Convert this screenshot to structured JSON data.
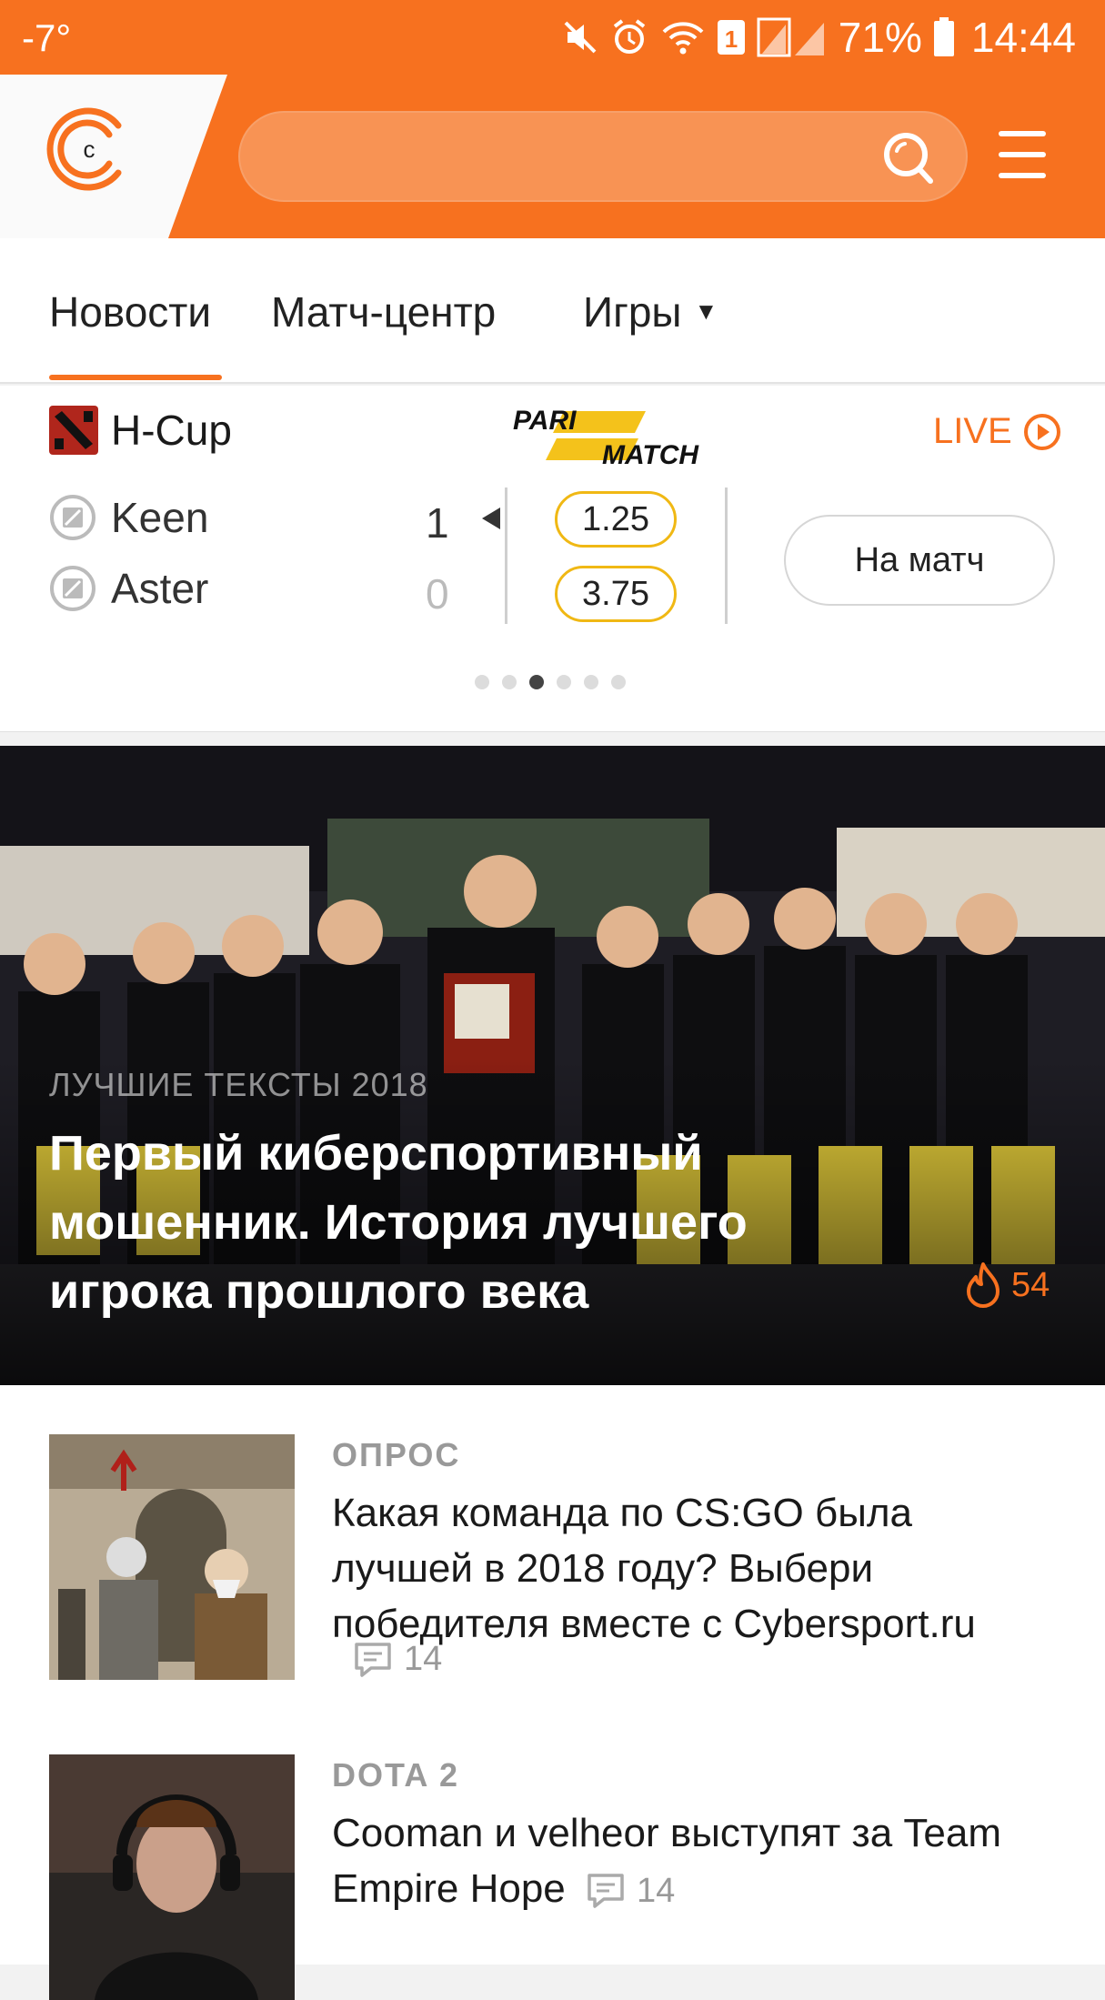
{
  "status_bar": {
    "temperature": "-7°",
    "battery": "71%",
    "time": "14:44",
    "sim_badge": "1"
  },
  "header": {
    "search": {
      "value": "",
      "placeholder": ""
    }
  },
  "tabs": [
    {
      "label": "Новости",
      "active": true
    },
    {
      "label": "Матч-центр",
      "active": false
    },
    {
      "label": "Игры",
      "active": false
    }
  ],
  "match": {
    "tournament": "H-Cup",
    "sponsor": "PARIMATCH",
    "live_label": "LIVE",
    "teams": [
      {
        "name": "Keen",
        "score": "1",
        "odds": "1.25"
      },
      {
        "name": "Aster",
        "score": "0",
        "odds": "3.75"
      }
    ],
    "button_label": "На матч",
    "pager": {
      "count": 6,
      "active_index": 2
    }
  },
  "hero": {
    "category": "ЛУЧШИЕ ТЕКСТЫ 2018",
    "title": "Первый киберспортивный мошенник. История лучшего игрока прошлого века",
    "hot_count": "54"
  },
  "articles": [
    {
      "category": "ОПРОС",
      "title": "Какая команда по CS:GO была лучшей в 2018 году? Выбери победителя вместе с Cybersport.ru",
      "comments": "14"
    },
    {
      "category": "DOTA 2",
      "title": "Cooman и velheor выступят за Team Empire Hope",
      "comments": "14"
    }
  ],
  "colors": {
    "brand": "#f7711f",
    "odds_border": "#f0b814",
    "muted": "#999999"
  }
}
